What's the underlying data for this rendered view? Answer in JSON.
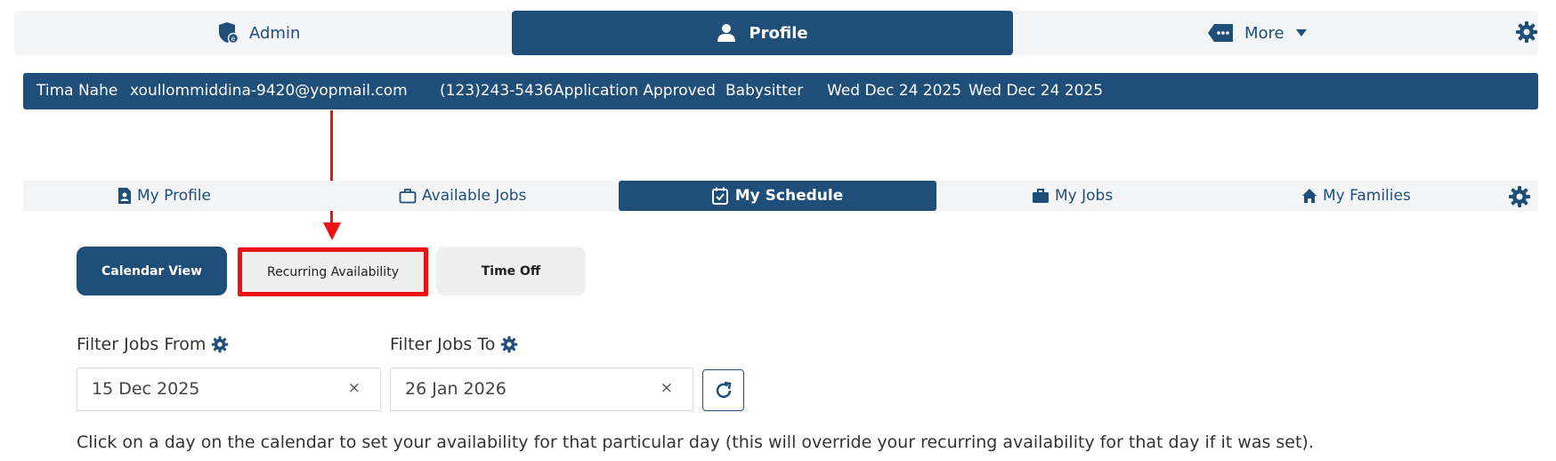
{
  "topnav": {
    "admin_label": "Admin",
    "profile_label": "Profile",
    "more_label": "More"
  },
  "infobar": {
    "name": "Tima Nahe",
    "email": "xoullommiddina-9420@yopmail.com",
    "phone": "(123)243-5436",
    "status": "Application Approved",
    "role": "Babysitter",
    "date1": "Wed Dec 24 2025",
    "date2": "Wed Dec 24 2025"
  },
  "subnav": {
    "tabs": [
      {
        "label": "My Profile"
      },
      {
        "label": "Available Jobs"
      },
      {
        "label": "My Schedule"
      },
      {
        "label": "My Jobs"
      },
      {
        "label": "My Families"
      }
    ],
    "active_index": 2
  },
  "schedule_buttons": {
    "calendar_view": "Calendar View",
    "recurring_availability": "Recurring Availability",
    "time_off": "Time Off"
  },
  "filters": {
    "from_label": "Filter Jobs From",
    "from_value": "15 Dec 2025",
    "to_label": "Filter Jobs To",
    "to_value": "26 Jan 2026",
    "clear_symbol": "×"
  },
  "hint_text": "Click on a day on the calendar to set your availability for that particular day (this will override your recurring availability for that day if it was set).",
  "colors": {
    "primary": "#1f4e79",
    "highlight": "#ee1111",
    "nav_bg": "#f3f5f7",
    "button_bg": "#efefef"
  }
}
